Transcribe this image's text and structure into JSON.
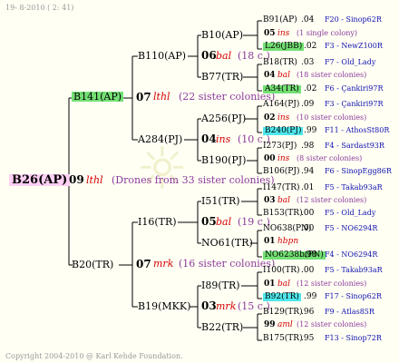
{
  "header": {
    "date": "19- 8-2010 ( 2: 41)",
    "title": "B26(AP) pedigree"
  },
  "footer": {
    "copyright": "Copyright 2004-2010 @ Karl Kehde Foundation."
  },
  "gen1": {
    "id": "B26(AP)"
  },
  "gen2_mid": {
    "num": "09",
    "race": "lthl",
    "note": "(Drones from 33 sister colonies)"
  },
  "gen2_top": {
    "id": "B141(AP)",
    "num": "07",
    "race": "lthl",
    "note": "(22 sister colonies)"
  },
  "gen2_bot": {
    "id": "B20(TR)",
    "num": "07",
    "race": "mrk",
    "note": "(16 sister colonies)"
  },
  "g3": [
    {
      "id": "B110(AP)",
      "num": "06",
      "race": "bal",
      "note": "(18 c.)"
    },
    {
      "id": "A284(PJ)",
      "num": "04",
      "race": "ins",
      "note": "(10 c.)"
    },
    {
      "id": "I16(TR)",
      "num": "05",
      "race": "bal",
      "note": "(19 c.)"
    },
    {
      "id": "B19(MKK)",
      "num": "03",
      "race": "mrk",
      "note": "(15 c.)"
    }
  ],
  "g4": [
    {
      "id": "B10(AP)"
    },
    {
      "id": "B77(TR)"
    },
    {
      "id": "A256(PJ)"
    },
    {
      "id": "B190(PJ)"
    },
    {
      "id": "I51(TR)"
    },
    {
      "id": "NO61(TR)"
    },
    {
      "id": "I89(TR)"
    },
    {
      "id": "B22(TR)"
    }
  ],
  "g5": [
    {
      "id": "B91(AP)",
      "num": ".04",
      "loc": "F20 - Sinop62R",
      "hl": ""
    },
    {
      "num": "05",
      "race": "ins",
      "note": "(1 single colony)"
    },
    {
      "id": "L26(JBB)",
      "num": ".02",
      "loc": "F3 - NewZ100R",
      "hl": "green"
    },
    {
      "id": "B18(TR)",
      "num": ".03",
      "loc": "F7 - Old_Lady",
      "hl": ""
    },
    {
      "num": "04",
      "race": "bal",
      "note": "(18 sister colonies)"
    },
    {
      "id": "A34(TR)",
      "num": ".02",
      "loc": "F6 - Çankiri97R",
      "hl": "green"
    },
    {
      "id": "A164(PJ)",
      "num": ".09",
      "loc": "F3 - Çankiri97R",
      "hl": ""
    },
    {
      "num": "02",
      "race": "ins",
      "note": "(10 sister colonies)"
    },
    {
      "id": "B240(PJ)",
      "num": ".99",
      "loc": "F11 - AthosSt80R",
      "hl": "cyan"
    },
    {
      "id": "I273(PJ)",
      "num": ".98",
      "loc": "F4 - Sardast93R",
      "hl": ""
    },
    {
      "num": "00",
      "race": "ins",
      "note": "(8 sister colonies)"
    },
    {
      "id": "B106(PJ)",
      "num": ".94",
      "loc": "F6 - SinopEgg86R",
      "hl": ""
    },
    {
      "id": "I147(TR)",
      "num": ".01",
      "loc": "F5 - Takab93aR",
      "hl": ""
    },
    {
      "num": "03",
      "race": "bal",
      "note": "(12 sister colonies)"
    },
    {
      "id": "B153(TR)",
      "num": ".00",
      "loc": "F5 - Old_Lady",
      "hl": ""
    },
    {
      "id": "NO638(PN)",
      "num": ".00",
      "loc": "F5 - NO6294R",
      "hl": ""
    },
    {
      "num": "01",
      "race": "hbpn",
      "note": ""
    },
    {
      "id": "NO6238b(PN)",
      "num": ".98",
      "loc": "F4 - NO6294R",
      "hl": "green"
    },
    {
      "id": "I100(TR)",
      "num": ".00",
      "loc": "F5 - Takab93aR",
      "hl": ""
    },
    {
      "num": "01",
      "race": "bal",
      "note": "(12 sister colonies)"
    },
    {
      "id": "B92(TR)",
      "num": ".99",
      "loc": "F17 - Sinop62R",
      "hl": "cyan"
    },
    {
      "id": "B129(TR)",
      "num": ".96",
      "loc": "F9 - Atlas85R",
      "hl": ""
    },
    {
      "num": "99",
      "race": "aml",
      "note": "(12 sister colonies)"
    },
    {
      "id": "B175(TR)",
      "num": ".95",
      "loc": "F13 - Sinop72R",
      "hl": ""
    }
  ]
}
